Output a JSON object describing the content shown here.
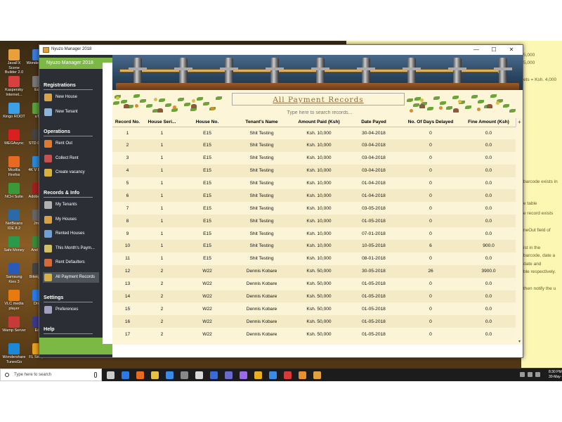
{
  "window": {
    "title": "Nyuzo Manager 2018",
    "minimize": "—",
    "maximize": "☐",
    "close": "✕"
  },
  "sidebar": {
    "app_name": "Nyuzo Manager 2018",
    "sections": [
      {
        "title": "Registrations",
        "items": [
          {
            "label": "New House",
            "icon": "house-icon"
          },
          {
            "label": "New Tenant",
            "icon": "tenant-icon"
          }
        ]
      },
      {
        "title": "Operations",
        "items": [
          {
            "label": "Rent Out",
            "icon": "key-icon"
          },
          {
            "label": "Collect Rent",
            "icon": "calendar-icon"
          },
          {
            "label": "Create vacancy",
            "icon": "lock-icon"
          }
        ]
      },
      {
        "title": "Records & Info",
        "items": [
          {
            "label": "My Tenants",
            "icon": "people-icon"
          },
          {
            "label": "My Houses",
            "icon": "houses-icon"
          },
          {
            "label": "Rented Houses",
            "icon": "rented-houses-icon"
          },
          {
            "label": "This Month's Paym...",
            "icon": "monthly-payment-icon"
          },
          {
            "label": "Rent Defaulters",
            "icon": "defaulters-icon"
          },
          {
            "label": "All Payment Records",
            "icon": "money-bag-icon",
            "active": true
          }
        ]
      },
      {
        "title": "Settings",
        "items": [
          {
            "label": "Preferences",
            "icon": "preferences-icon"
          }
        ]
      },
      {
        "title": "Help",
        "items": [
          {
            "label": "Contact Developer",
            "icon": "contact-icon"
          }
        ]
      }
    ]
  },
  "main": {
    "page_title": "All Payment Records",
    "search_placeholder": "Type here to search records...",
    "add_column_symbol": "+",
    "table": {
      "columns": [
        "Record No.",
        "House Seri...",
        "House No.",
        "Tenant's Name",
        "Amount Paid (Ksh)",
        "Date Payed",
        "No. Of Days Delayed",
        "Fine Amount (Ksh)"
      ],
      "rows": [
        [
          "1",
          "1",
          "E15",
          "Shit Testing",
          "Ksh. 10,000",
          "30-04-2018",
          "0",
          "0.0"
        ],
        [
          "2",
          "1",
          "E15",
          "Shit Testing",
          "Ksh. 10,000",
          "03-04-2018",
          "0",
          "0.0"
        ],
        [
          "3",
          "1",
          "E15",
          "Shit Testing",
          "Ksh. 10,000",
          "03-04-2018",
          "0",
          "0.0"
        ],
        [
          "4",
          "1",
          "E15",
          "Shit Testing",
          "Ksh. 10,000",
          "03-04-2018",
          "0",
          "0.0"
        ],
        [
          "5",
          "1",
          "E15",
          "Shit Testing",
          "Ksh. 10,000",
          "01-04-2018",
          "0",
          "0.0"
        ],
        [
          "6",
          "1",
          "E15",
          "Shit Testing",
          "Ksh. 10,000",
          "01-04-2018",
          "0",
          "0.0"
        ],
        [
          "7",
          "1",
          "E15",
          "Shit Testing",
          "Ksh. 10,000",
          "03-05-2018",
          "0",
          "0.0"
        ],
        [
          "8",
          "1",
          "E15",
          "Shit Testing",
          "Ksh. 10,000",
          "01-05-2018",
          "0",
          "0.0"
        ],
        [
          "9",
          "1",
          "E15",
          "Shit Testing",
          "Ksh. 10,000",
          "07-01-2018",
          "0",
          "0.0"
        ],
        [
          "10",
          "1",
          "E15",
          "Shit Testing",
          "Ksh. 10,000",
          "10-05-2018",
          "6",
          "900.0"
        ],
        [
          "11",
          "1",
          "E15",
          "Shit Testing",
          "Ksh. 10,000",
          "08-01-2018",
          "0",
          "0.0"
        ],
        [
          "12",
          "2",
          "W22",
          "Dennis Kobare",
          "Ksh. 50,000",
          "30-05-2018",
          "26",
          "3900.0"
        ],
        [
          "13",
          "2",
          "W22",
          "Dennis Kobare",
          "Ksh. 50,000",
          "01-05-2018",
          "0",
          "0.0"
        ],
        [
          "14",
          "2",
          "W22",
          "Dennis Kobare",
          "Ksh. 50,000",
          "01-05-2018",
          "0",
          "0.0"
        ],
        [
          "15",
          "2",
          "W22",
          "Dennis Kobare",
          "Ksh. 50,000",
          "01-05-2018",
          "0",
          "0.0"
        ],
        [
          "16",
          "2",
          "W22",
          "Dennis Kobare",
          "Ksh. 50,000",
          "01-05-2018",
          "0",
          "0.0"
        ],
        [
          "17",
          "2",
          "W22",
          "Dennis Kobare",
          "Ksh. 50,000",
          "01-05-2018",
          "0",
          "0.0"
        ]
      ]
    }
  },
  "desktop": {
    "icons": [
      {
        "label": "JavaFX Scene Builder 2.0",
        "color": "#e8a03a"
      },
      {
        "label": "Wonde Video",
        "color": "#3a7ad8"
      },
      {
        "label": "Kaspersky Internet...",
        "color": "#d84040"
      },
      {
        "label": "Equ",
        "color": "#777777"
      },
      {
        "label": "Kingo ROOT",
        "color": "#3aa0e8"
      },
      {
        "label": "uTo",
        "color": "#5aa03a"
      },
      {
        "label": "MEGAsync",
        "color": "#d82020"
      },
      {
        "label": "STD Down",
        "color": "#444444"
      },
      {
        "label": "Mozilla Firefox",
        "color": "#e86a20"
      },
      {
        "label": "4K V Down",
        "color": "#2a8ad8"
      },
      {
        "label": "NCH Suite",
        "color": "#3a9a3a"
      },
      {
        "label": "Adobe Enc",
        "color": "#a02020"
      },
      {
        "label": "NetBeans IDE 8.2",
        "color": "#2a6aa8"
      },
      {
        "label": "Jmar",
        "color": "#666666"
      },
      {
        "label": "Safe Money",
        "color": "#2a9a4a"
      },
      {
        "label": "And Stu",
        "color": "#3a8a3a"
      },
      {
        "label": "Samsung Kies 3",
        "color": "#2a5ab8"
      },
      {
        "label": "Bitwig Stu",
        "color": "#444444"
      },
      {
        "label": "VLC media player",
        "color": "#e87a10"
      },
      {
        "label": "Drop",
        "color": "#2a7ae8"
      },
      {
        "label": "Wamp Server",
        "color": "#c83a3a"
      },
      {
        "label": "Ecli",
        "color": "#3a3a8a"
      },
      {
        "label": "Wondershare TunesGo",
        "color": "#1a8ad8"
      },
      {
        "label": "FL Stu (64",
        "color": "#e8a020"
      }
    ],
    "sticky_notes": [
      "5,000",
      "5,000",
      "ets = Ksh. 4,000",
      "barcode exists in",
      "e table",
      "e record exists",
      "neOut field of",
      "ist in the",
      "barcode, date a",
      "date and",
      "ble respectively.",
      "then notify the u"
    ]
  },
  "taskbar": {
    "search_placeholder": "Type here to search",
    "time": "8:30 PM",
    "date": "30-May-",
    "app_icons": [
      {
        "name": "task-view-icon",
        "color": "#cccccc"
      },
      {
        "name": "edge-icon",
        "color": "#2a7ae8"
      },
      {
        "name": "firefox-icon",
        "color": "#e86a20"
      },
      {
        "name": "file-explorer-icon",
        "color": "#e8c040"
      },
      {
        "name": "store-icon",
        "color": "#3a8ae8"
      },
      {
        "name": "app-icon-6",
        "color": "#888888"
      },
      {
        "name": "app-icon-7",
        "color": "#d8d8d8"
      },
      {
        "name": "app-icon-8",
        "color": "#3a6ad8"
      },
      {
        "name": "app-icon-9",
        "color": "#6a6ac8"
      },
      {
        "name": "app-icon-10",
        "color": "#9a6ae8"
      },
      {
        "name": "chrome-icon",
        "color": "#e8b020"
      },
      {
        "name": "app-icon-12",
        "color": "#3a8ae8"
      },
      {
        "name": "app-icon-13",
        "color": "#d83a3a"
      },
      {
        "name": "app-icon-14",
        "color": "#e89030"
      },
      {
        "name": "nyuzo-manager-taskbar-icon",
        "color": "#e0a040"
      }
    ]
  },
  "colors": {
    "sidebar_bg": "#2b2f35",
    "accent_green": "#7cb944",
    "content_bg": "#fdf5d8",
    "row_alt": "#f4ebc6",
    "title_color": "#8a6a3a"
  }
}
